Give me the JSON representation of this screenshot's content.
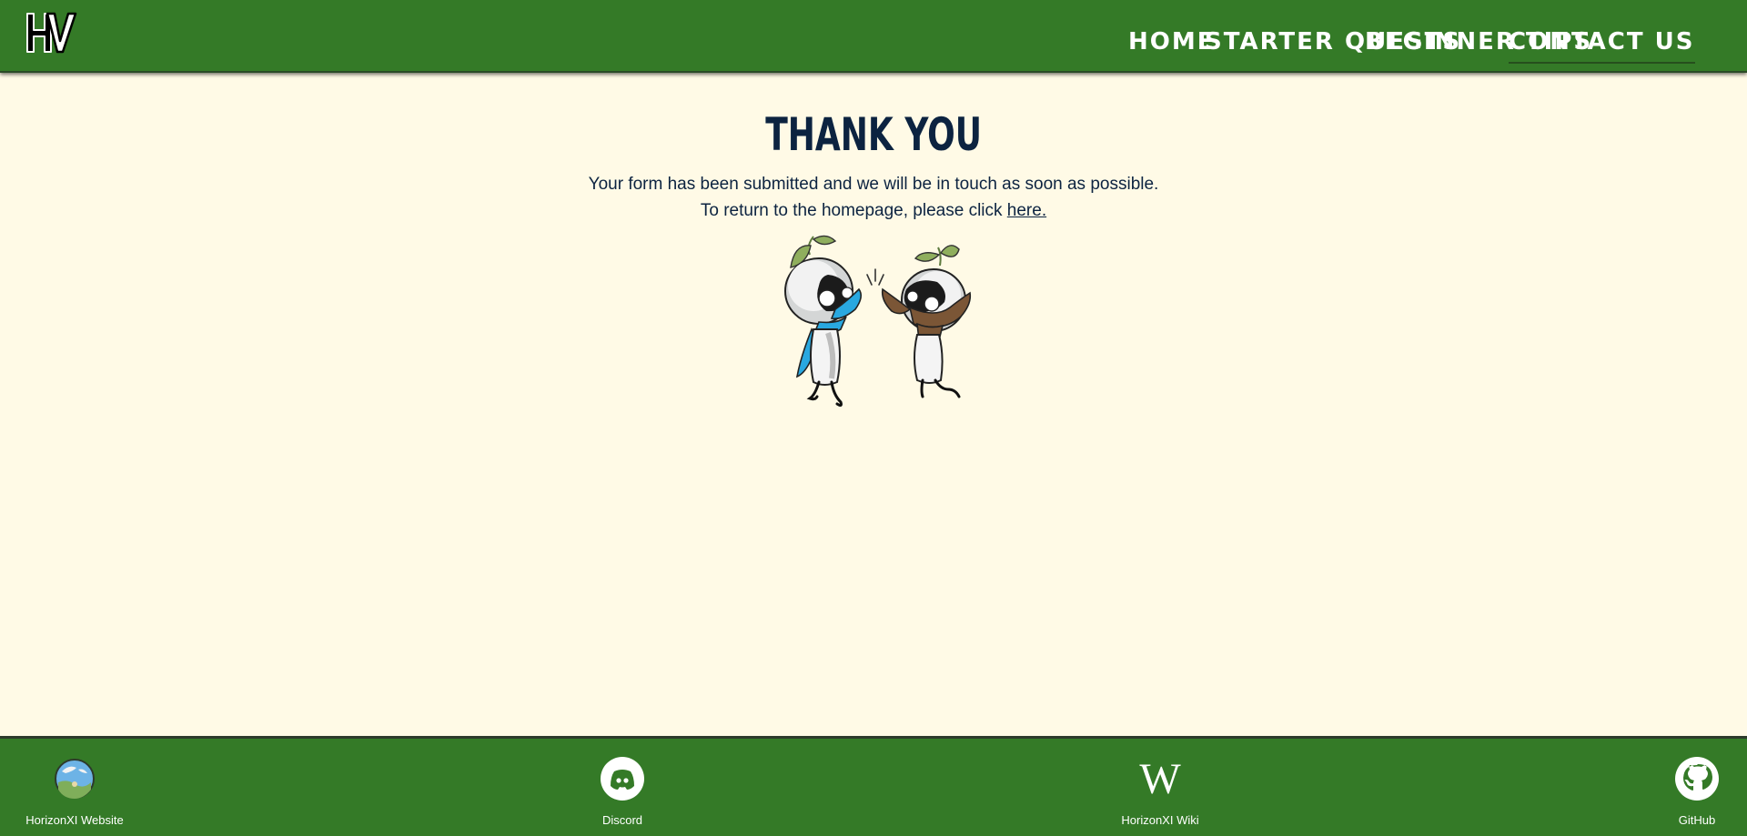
{
  "header": {
    "logo_icon": "horizon-hv-logo-icon",
    "nav": [
      {
        "label": "HOME",
        "active": false
      },
      {
        "label": "STARTER QUESTS",
        "active": false
      },
      {
        "label": "BEGINNER TIPS",
        "active": false
      },
      {
        "label": "CONTACT US",
        "active": true
      }
    ]
  },
  "main": {
    "title": "THANK YOU",
    "message_line1": "Your form has been submitted and we will be in touch as soon as possible.",
    "message_line2_prefix": "To return to the homepage, please click ",
    "message_link": "here.",
    "illustration_icon": "mandragora-high-five-illustration"
  },
  "footer": {
    "links": [
      {
        "label": "HorizonXI Website",
        "icon": "horizonxi-globe-icon"
      },
      {
        "label": "Discord",
        "icon": "discord-icon"
      },
      {
        "label": "HorizonXI Wiki",
        "icon": "wikipedia-w-icon"
      },
      {
        "label": "GitHub",
        "icon": "github-icon"
      }
    ]
  },
  "colors": {
    "header_bg": "#347a27",
    "page_bg": "#fffae6",
    "heading": "#0c2340",
    "nav_text": "#ffffff"
  }
}
